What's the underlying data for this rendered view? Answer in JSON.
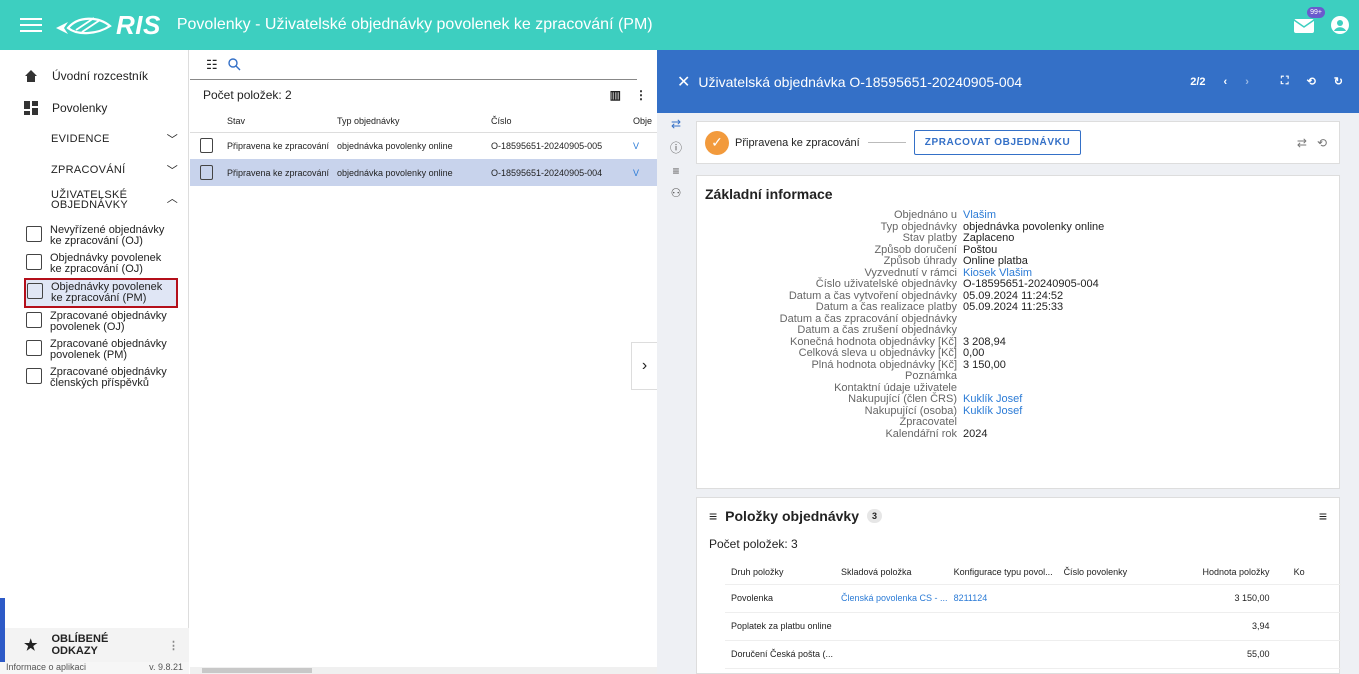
{
  "header": {
    "brand": "RIS",
    "title": "Povolenky - Uživatelské objednávky povolenek ke zpracování (PM)",
    "notif_badge": "99+"
  },
  "sidebar": {
    "home": "Úvodní rozcestník",
    "povolenky": "Povolenky",
    "evidence": "EVIDENCE",
    "zpracovani": "ZPRACOVÁNÍ",
    "uziv_obj": "UŽIVATELSKÉ OBJEDNÁVKY",
    "items": [
      "Nevyřízené objednávky ke zpracování (OJ)",
      "Objednávky povolenek ke zpracování (OJ)",
      "Objednávky povolenek ke zpracování (PM)",
      "Zpracované objednávky povolenek (OJ)",
      "Zpracované objednávky povolenek (PM)",
      "Zpracované objednávky členských příspěvků"
    ],
    "favorites": "OBLÍBENÉ ODKAZY",
    "footer_left": "Informace o aplikaci",
    "footer_right": "v. 9.8.21"
  },
  "list": {
    "count": "Počet položek: 2",
    "columns": [
      "Stav",
      "Typ objednávky",
      "Číslo",
      "Obje"
    ],
    "rows": [
      {
        "stav": "Připravena ke zpracování",
        "typ": "objednávka povolenky online",
        "cislo": "O-18595651-20240905-005",
        "obje": "V"
      },
      {
        "stav": "Připravena ke zpracování",
        "typ": "objednávka povolenky online",
        "cislo": "O-18595651-20240905-004",
        "obje": "V"
      }
    ]
  },
  "detail": {
    "title": "Uživatelská objednávka O-18595651-20240905-004",
    "pager": "2/2",
    "status": "Připravena ke zpracování",
    "process_btn": "ZPRACOVAT OBJEDNÁVKU",
    "info_title": "Základní informace",
    "fields": [
      {
        "k": "Objednáno u",
        "v": "Vlašim",
        "link": true
      },
      {
        "k": "Typ objednávky",
        "v": "objednávka povolenky online",
        "link": false
      },
      {
        "k": "Stav platby",
        "v": "Zaplaceno",
        "link": false
      },
      {
        "k": "Způsob doručení",
        "v": "Poštou",
        "link": false
      },
      {
        "k": "Způsob úhrady",
        "v": "Online platba",
        "link": false
      },
      {
        "k": "Vyzvednutí v rámci",
        "v": "Kiosek Vlašim",
        "link": true
      },
      {
        "k": "Číslo uživatelské objednávky",
        "v": "O-18595651-20240905-004",
        "link": false
      },
      {
        "k": "Datum a čas vytvoření objednávky",
        "v": "05.09.2024 11:24:52",
        "link": false
      },
      {
        "k": "Datum a čas realizace platby",
        "v": "05.09.2024 11:25:33",
        "link": false
      },
      {
        "k": "Datum a čas zpracování objednávky",
        "v": "",
        "link": false
      },
      {
        "k": "Datum a čas zrušení objednávky",
        "v": "",
        "link": false
      },
      {
        "k": "Konečná hodnota objednávky [Kč]",
        "v": "3 208,94",
        "link": false
      },
      {
        "k": "Celková sleva u objednávky [Kč]",
        "v": "0,00",
        "link": false
      },
      {
        "k": "Plná hodnota objednávky [Kč]",
        "v": "3 150,00",
        "link": false
      },
      {
        "k": "Poznámka",
        "v": "",
        "link": false
      },
      {
        "k": "Kontaktní údaje uživatele",
        "v": "",
        "link": false
      },
      {
        "k": "Nakupující (člen ČRS)",
        "v": "Kuklík Josef",
        "link": true
      },
      {
        "k": "Nakupující (osoba)",
        "v": "Kuklík Josef",
        "link": true
      },
      {
        "k": "Zpracovatel",
        "v": "",
        "link": false
      },
      {
        "k": "Kalendářní rok",
        "v": "2024",
        "link": false
      }
    ],
    "items_title": "Položky objednávky",
    "items_badge": "3",
    "items_count": "Počet položek: 3",
    "items_columns": [
      "Druh položky",
      "Skladová položka",
      "Konfigurace typu povol...",
      "Číslo povolenky",
      "Hodnota položky",
      "Ko"
    ],
    "items": [
      {
        "druh": "Povolenka",
        "sklad": "Členská povolenka CS - ...",
        "konf": "8211124",
        "cislo": "",
        "hodnota": "3 150,00"
      },
      {
        "druh": "Poplatek za platbu online",
        "sklad": "",
        "konf": "",
        "cislo": "",
        "hodnota": "3,94"
      },
      {
        "druh": "Doručení Česká pošta (...",
        "sklad": "",
        "konf": "",
        "cislo": "",
        "hodnota": "55,00"
      }
    ]
  }
}
